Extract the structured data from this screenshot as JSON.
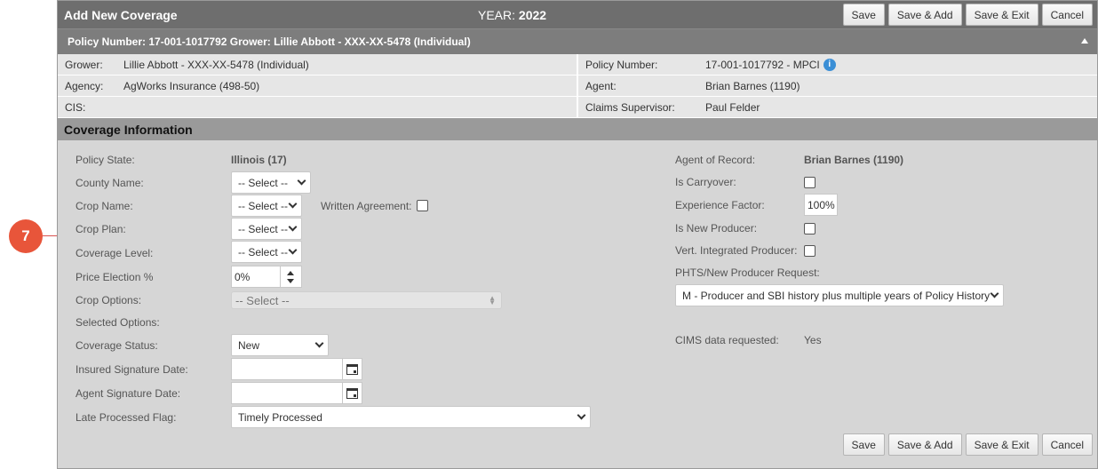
{
  "callout": "7",
  "header": {
    "title": "Add New Coverage",
    "year_label": "YEAR:",
    "year_value": "2022",
    "buttons": {
      "save": "Save",
      "save_add": "Save & Add",
      "save_exit": "Save & Exit",
      "cancel": "Cancel"
    }
  },
  "policy_bar": "Policy Number: 17-001-1017792 Grower: Lillie Abbott - XXX-XX-5478 (Individual)",
  "info": {
    "grower_label": "Grower:",
    "grower_value": "Lillie Abbott - XXX-XX-5478 (Individual)",
    "agency_label": "Agency:",
    "agency_value": "AgWorks Insurance (498-50)",
    "cis_label": "CIS:",
    "policy_number_label": "Policy Number:",
    "policy_number_value": "17-001-1017792 - MPCI",
    "agent_label": "Agent:",
    "agent_value": "Brian Barnes (1190)",
    "claims_label": "Claims Supervisor:",
    "claims_value": "Paul Felder"
  },
  "section_title": "Coverage Information",
  "form": {
    "policy_state_label": "Policy State:",
    "policy_state_value": "Illinois (17)",
    "county_label": "County Name:",
    "county_value": "-- Select --",
    "crop_name_label": "Crop Name:",
    "crop_name_value": "-- Select --",
    "written_agreement_label": "Written Agreement:",
    "crop_plan_label": "Crop Plan:",
    "crop_plan_value": "-- Select --",
    "coverage_level_label": "Coverage Level:",
    "coverage_level_value": "-- Select --",
    "price_election_label": "Price Election %",
    "price_election_value": "0%",
    "crop_options_label": "Crop Options:",
    "crop_options_value": "-- Select --",
    "selected_options_label": "Selected Options:",
    "coverage_status_label": "Coverage Status:",
    "coverage_status_value": "New",
    "insured_sig_label": "Insured Signature Date:",
    "agent_sig_label": "Agent Signature Date:",
    "late_flag_label": "Late Processed Flag:",
    "late_flag_value": "Timely Processed",
    "agent_of_record_label": "Agent of Record:",
    "agent_of_record_value": "Brian Barnes (1190)",
    "carryover_label": "Is Carryover:",
    "experience_label": "Experience Factor:",
    "experience_value": "100%",
    "new_producer_label": "Is New Producer:",
    "vert_label": "Vert. Integrated Producer:",
    "phts_label": "PHTS/New Producer Request:",
    "phts_value": "M - Producer and SBI history plus multiple years of Policy History",
    "cims_label": "CIMS data requested:",
    "cims_value": "Yes"
  }
}
